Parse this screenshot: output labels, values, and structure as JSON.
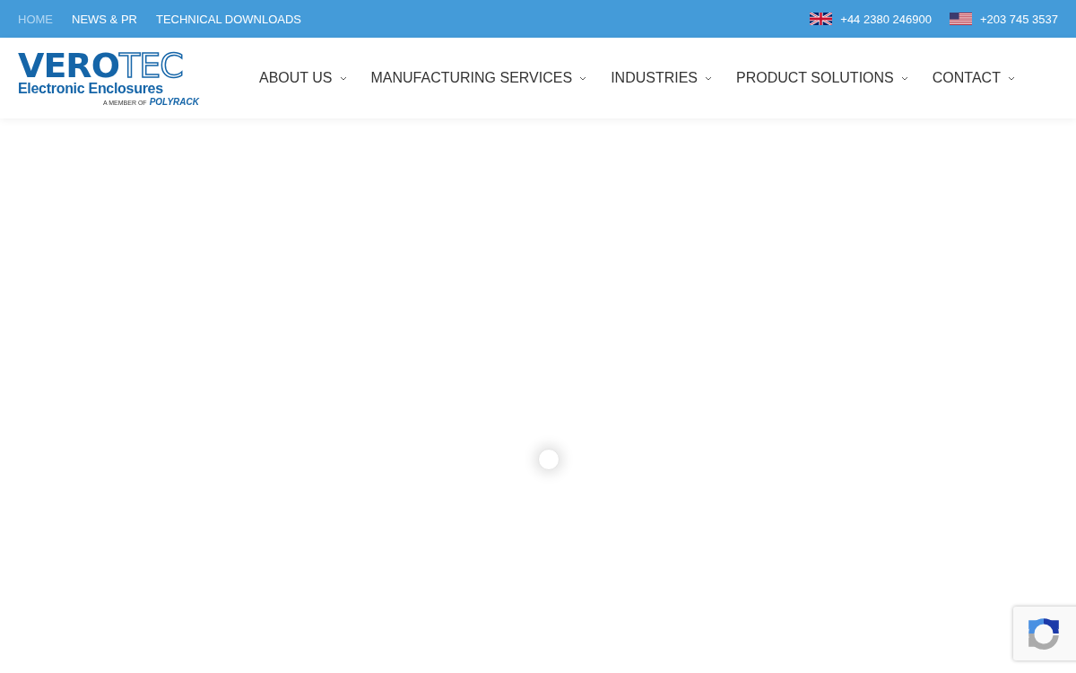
{
  "top_bar": {
    "links": [
      {
        "label": "HOME",
        "selected": true
      },
      {
        "label": "NEWS & PR",
        "selected": false
      },
      {
        "label": "TECHNICAL DOWNLOADS",
        "selected": false
      }
    ],
    "phones": [
      {
        "kind": "uk",
        "number": "+44 2380 246900"
      },
      {
        "kind": "us",
        "number": "+203 745 3537"
      }
    ]
  },
  "logo": {
    "name_filled": "VERO",
    "name_outline": "TEC",
    "tagline": "Electronic Enclosures",
    "member_text": "A MEMBER OF",
    "member_brand": "POLYRACK"
  },
  "nav": [
    {
      "label": "ABOUT US",
      "has_submenu": true
    },
    {
      "label": "MANUFACTURING SERVICES",
      "has_submenu": true
    },
    {
      "label": "INDUSTRIES",
      "has_submenu": true
    },
    {
      "label": "PRODUCT SOLUTIONS",
      "has_submenu": true
    },
    {
      "label": "CONTACT",
      "has_submenu": true
    }
  ],
  "loading": true,
  "recaptcha_badge": true
}
